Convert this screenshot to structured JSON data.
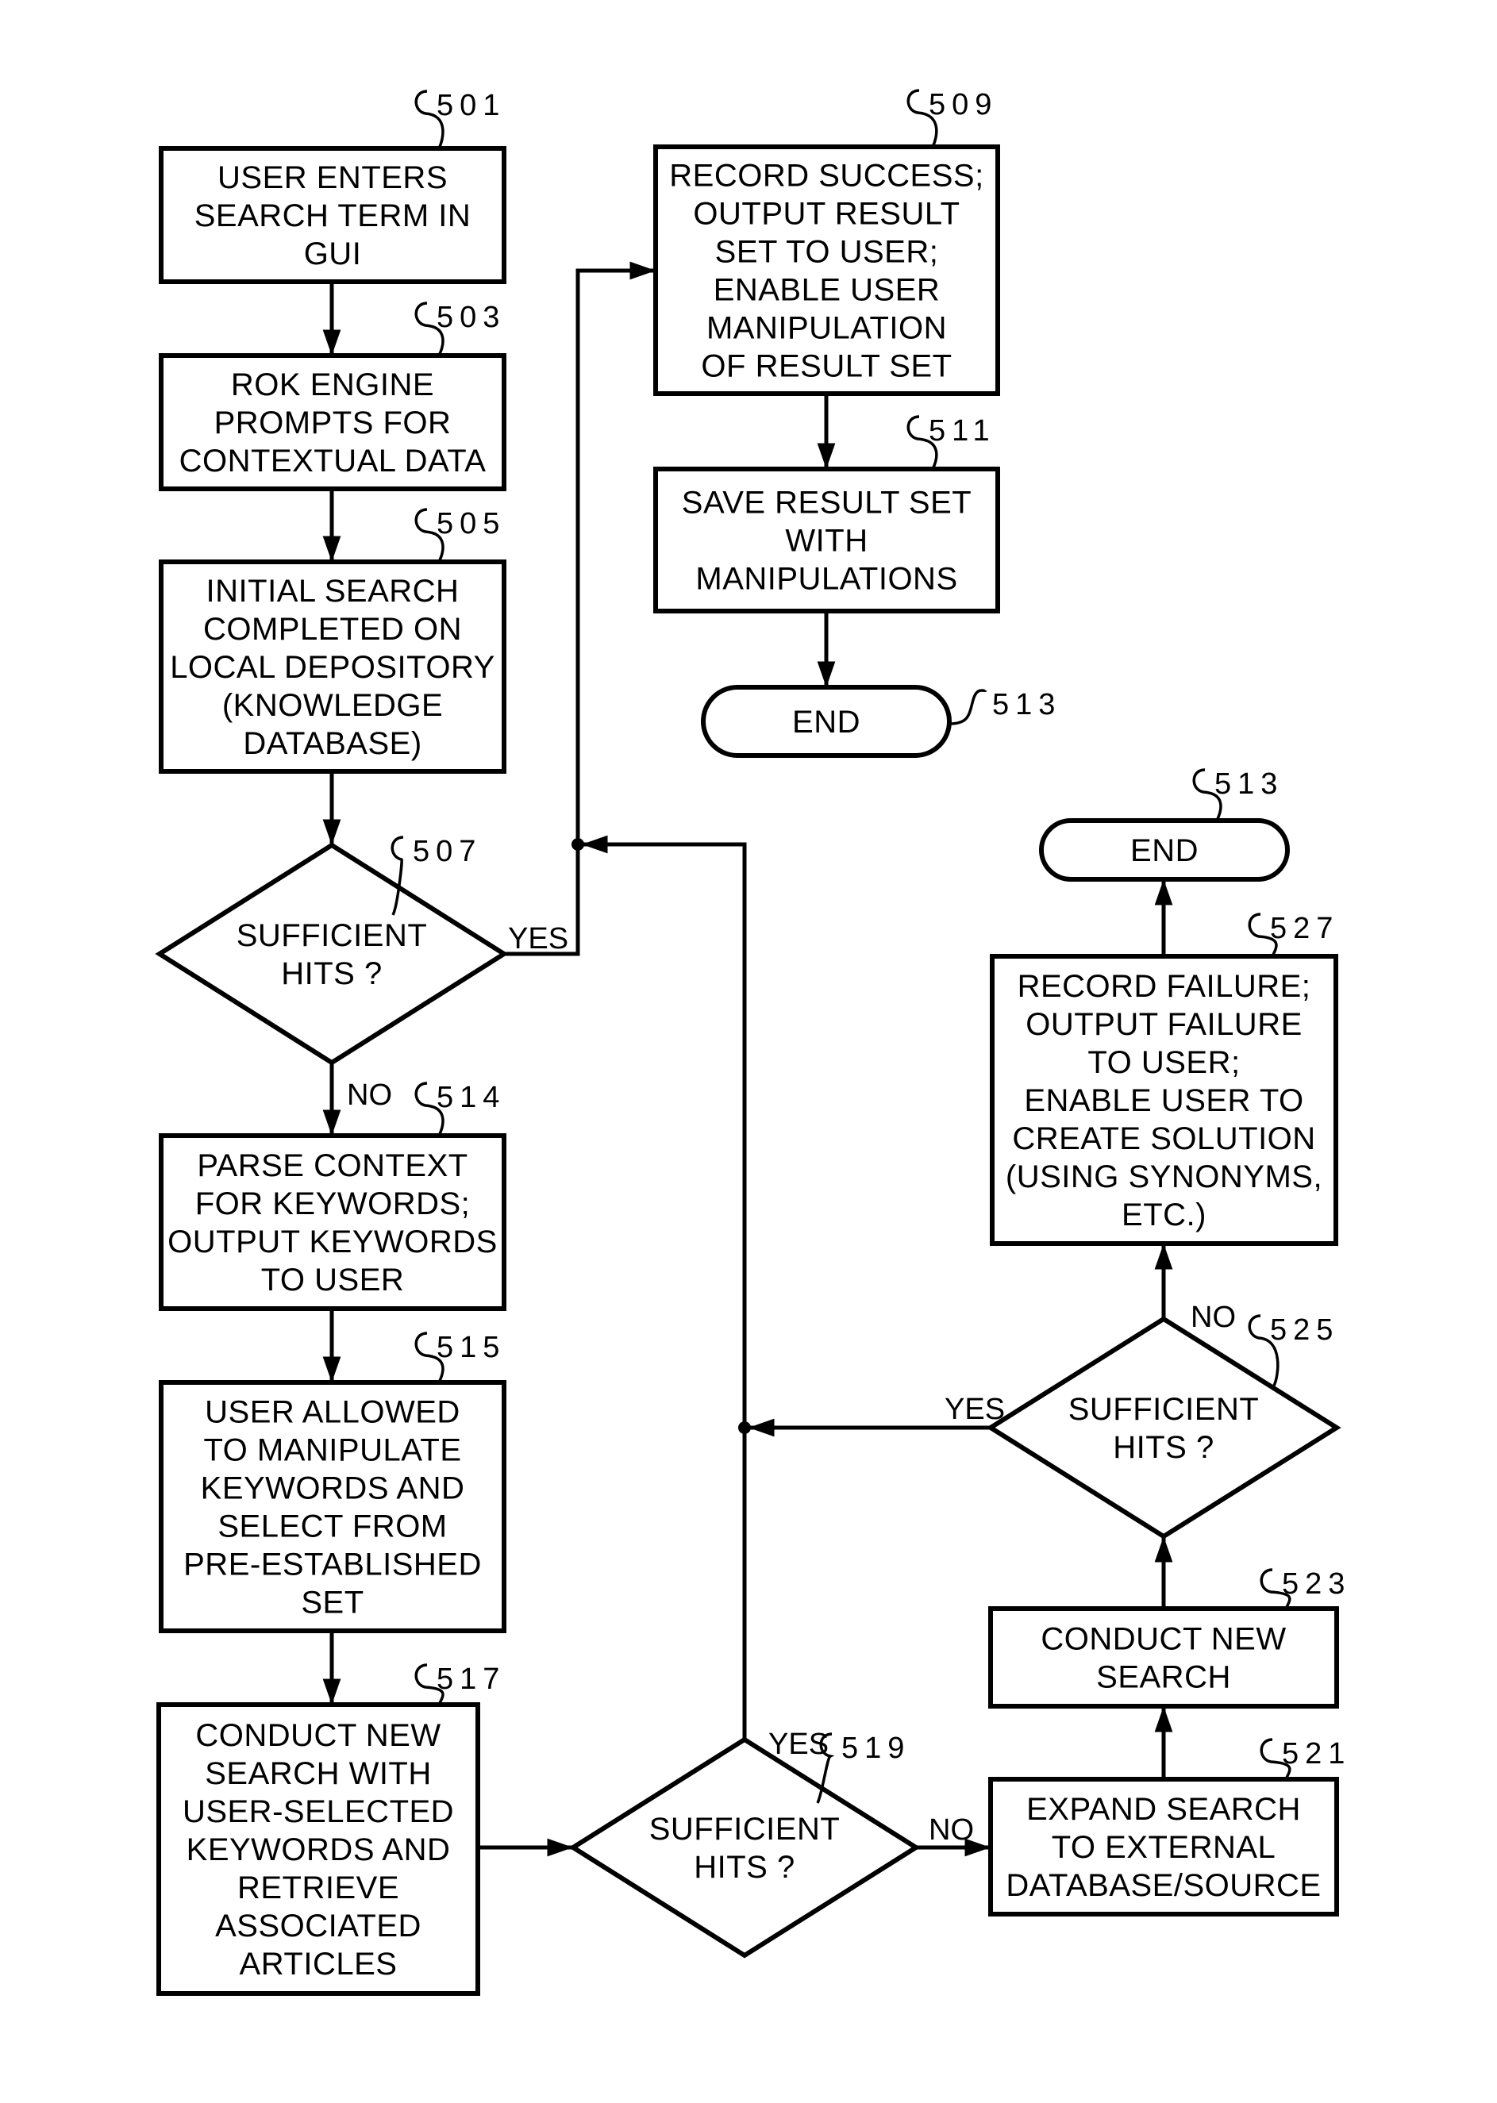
{
  "diagram": {
    "type": "flowchart",
    "nodes": [
      {
        "id": "501",
        "kind": "process",
        "ref": "501",
        "lines": [
          "USER ENTERS",
          "SEARCH TERM IN",
          "GUI"
        ]
      },
      {
        "id": "503",
        "kind": "process",
        "ref": "503",
        "lines": [
          "ROK ENGINE",
          "PROMPTS FOR",
          "CONTEXTUAL DATA"
        ]
      },
      {
        "id": "505",
        "kind": "process",
        "ref": "505",
        "lines": [
          "INITIAL SEARCH",
          "COMPLETED ON",
          "LOCAL DEPOSITORY",
          "(KNOWLEDGE",
          "DATABASE)"
        ]
      },
      {
        "id": "507",
        "kind": "decision",
        "ref": "507",
        "lines": [
          "SUFFICIENT",
          "HITS ?"
        ]
      },
      {
        "id": "509",
        "kind": "process",
        "ref": "509",
        "lines": [
          "RECORD SUCCESS;",
          "OUTPUT RESULT",
          "SET TO USER;",
          "ENABLE USER",
          "MANIPULATION",
          "OF RESULT SET"
        ]
      },
      {
        "id": "511",
        "kind": "process",
        "ref": "511",
        "lines": [
          "SAVE RESULT SET",
          "WITH",
          "MANIPULATIONS"
        ]
      },
      {
        "id": "513a",
        "kind": "terminal",
        "ref": "513",
        "lines": [
          "END"
        ]
      },
      {
        "id": "514",
        "kind": "process",
        "ref": "514",
        "lines": [
          "PARSE CONTEXT",
          "FOR KEYWORDS;",
          "OUTPUT KEYWORDS",
          "TO USER"
        ]
      },
      {
        "id": "515",
        "kind": "process",
        "ref": "515",
        "lines": [
          "USER ALLOWED",
          "TO MANIPULATE",
          "KEYWORDS AND",
          "SELECT FROM",
          "PRE-ESTABLISHED",
          "SET"
        ]
      },
      {
        "id": "517",
        "kind": "process",
        "ref": "517",
        "lines": [
          "CONDUCT NEW",
          "SEARCH WITH",
          "USER-SELECTED",
          "KEYWORDS AND",
          "RETRIEVE",
          "ASSOCIATED",
          "ARTICLES"
        ]
      },
      {
        "id": "519",
        "kind": "decision",
        "ref": "519",
        "lines": [
          "SUFFICIENT",
          "HITS ?"
        ]
      },
      {
        "id": "521",
        "kind": "process",
        "ref": "521",
        "lines": [
          "EXPAND SEARCH",
          "TO EXTERNAL",
          "DATABASE/SOURCE"
        ]
      },
      {
        "id": "523",
        "kind": "process",
        "ref": "523",
        "lines": [
          "CONDUCT NEW",
          "SEARCH"
        ]
      },
      {
        "id": "525",
        "kind": "decision",
        "ref": "525",
        "lines": [
          "SUFFICIENT",
          "HITS ?"
        ]
      },
      {
        "id": "527",
        "kind": "process",
        "ref": "527",
        "lines": [
          "RECORD FAILURE;",
          "OUTPUT FAILURE",
          "TO USER;",
          "ENABLE USER TO",
          "CREATE SOLUTION",
          "(USING SYNONYMS,",
          "ETC.)"
        ]
      },
      {
        "id": "513b",
        "kind": "terminal",
        "ref": "513",
        "lines": [
          "END"
        ]
      }
    ],
    "edges": [
      {
        "from": "501",
        "to": "503",
        "label": ""
      },
      {
        "from": "503",
        "to": "505",
        "label": ""
      },
      {
        "from": "505",
        "to": "507",
        "label": ""
      },
      {
        "from": "507",
        "to": "509",
        "label": "YES"
      },
      {
        "from": "507",
        "to": "514",
        "label": "NO"
      },
      {
        "from": "509",
        "to": "511",
        "label": ""
      },
      {
        "from": "511",
        "to": "513a",
        "label": ""
      },
      {
        "from": "514",
        "to": "515",
        "label": ""
      },
      {
        "from": "515",
        "to": "517",
        "label": ""
      },
      {
        "from": "517",
        "to": "519",
        "label": ""
      },
      {
        "from": "519",
        "to": "509",
        "label": "YES"
      },
      {
        "from": "519",
        "to": "521",
        "label": "NO"
      },
      {
        "from": "521",
        "to": "523",
        "label": ""
      },
      {
        "from": "523",
        "to": "525",
        "label": ""
      },
      {
        "from": "525",
        "to": "509",
        "label": "YES"
      },
      {
        "from": "525",
        "to": "527",
        "label": "NO"
      },
      {
        "from": "527",
        "to": "513b",
        "label": ""
      }
    ],
    "labels": {
      "yes": "YES",
      "no": "NO"
    }
  }
}
